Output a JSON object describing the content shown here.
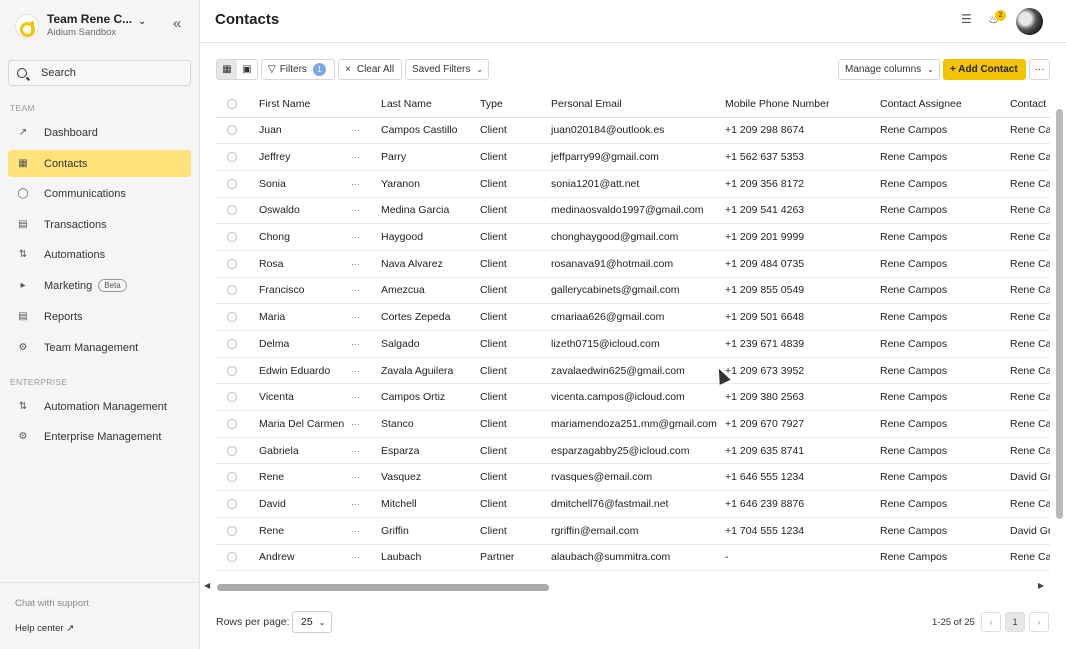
{
  "sidebar": {
    "team_name": "Team Rene C...",
    "team_sub": "Aidium Sandbox",
    "search_placeholder": "Search",
    "section_team": "TEAM",
    "section_enterprise": "ENTERPRISE",
    "items": [
      {
        "label": "Dashboard",
        "icon": "chart-icon"
      },
      {
        "label": "Contacts",
        "icon": "contacts-icon",
        "active": true
      },
      {
        "label": "Communications",
        "icon": "chat-icon"
      },
      {
        "label": "Transactions",
        "icon": "document-icon"
      },
      {
        "label": "Automations",
        "icon": "automation-icon"
      },
      {
        "label": "Marketing",
        "icon": "megaphone-icon",
        "badge": "Beta"
      },
      {
        "label": "Reports",
        "icon": "report-icon"
      },
      {
        "label": "Team Management",
        "icon": "gear-icon"
      }
    ],
    "enterprise_items": [
      {
        "label": "Automation Management",
        "icon": "automation-icon"
      },
      {
        "label": "Enterprise Management",
        "icon": "gear-icon"
      }
    ],
    "chat_support": "Chat with support",
    "help_center": "Help center"
  },
  "header": {
    "title": "Contacts",
    "notification_count": "2"
  },
  "toolbar": {
    "filters_label": "Filters",
    "filters_count": "1",
    "clear_all": "Clear All",
    "saved_filters": "Saved Filters",
    "manage_columns": "Manage columns",
    "add_contact": "+ Add Contact",
    "more": "···"
  },
  "table": {
    "columns": [
      "First Name",
      "Last Name",
      "Type",
      "Personal Email",
      "Mobile Phone Number",
      "Contact Assignee",
      "Contact"
    ],
    "rows": [
      [
        "Juan",
        "Campos Castillo",
        "Client",
        "juan020184@outlook.es",
        "+1 209 298 8674",
        "Rene Campos",
        "Rene Ca"
      ],
      [
        "Jeffrey",
        "Parry",
        "Client",
        "jeffparry99@gmail.com",
        "+1 562 637 5353",
        "Rene Campos",
        "Rene Ca"
      ],
      [
        "Sonia",
        "Yaranon",
        "Client",
        "sonia1201@att.net",
        "+1 209 356 8172",
        "Rene Campos",
        "Rene Ca"
      ],
      [
        "Oswaldo",
        "Medina Garcia",
        "Client",
        "medinaosvaldo1997@gmail.com",
        "+1 209 541 4263",
        "Rene Campos",
        "Rene Ca"
      ],
      [
        "Chong",
        "Haygood",
        "Client",
        "chonghaygood@gmail.com",
        "+1 209 201 9999",
        "Rene Campos",
        "Rene Ca"
      ],
      [
        "Rosa",
        "Nava Alvarez",
        "Client",
        "rosanava91@hotmail.com",
        "+1 209 484 0735",
        "Rene Campos",
        "Rene Ca"
      ],
      [
        "Francisco",
        "Amezcua",
        "Client",
        "gallerycabinets@gmail.com",
        "+1 209 855 0549",
        "Rene Campos",
        "Rene Ca"
      ],
      [
        "Maria",
        "Cortes Zepeda",
        "Client",
        "cmariaa626@gmail.com",
        "+1 209 501 6648",
        "Rene Campos",
        "Rene Ca"
      ],
      [
        "Delma",
        "Salgado",
        "Client",
        "lizeth0715@icloud.com",
        "+1 239 671 4839",
        "Rene Campos",
        "Rene Ca"
      ],
      [
        "Edwin Eduardo",
        "Zavala Aguilera",
        "Client",
        "zavalaedwin625@gmail.com",
        "+1 209 673 3952",
        "Rene Campos",
        "Rene Ca"
      ],
      [
        "Vicenta",
        "Campos Ortiz",
        "Client",
        "vicenta.campos@icloud.com",
        "+1 209 380 2563",
        "Rene Campos",
        "Rene Ca"
      ],
      [
        "Maria Del Carmen",
        "Stanco",
        "Client",
        "mariamendoza251.mm@gmail.com",
        "+1 209 670 7927",
        "Rene Campos",
        "Rene Ca"
      ],
      [
        "Gabriela",
        "Esparza",
        "Client",
        "esparzagabby25@icloud.com",
        "+1 209 635 8741",
        "Rene Campos",
        "Rene Ca"
      ],
      [
        "Rene",
        "Vasquez",
        "Client",
        "rvasques@email.com",
        "+1 646 555 1234",
        "Rene Campos",
        "David Gr"
      ],
      [
        "David",
        "Mitchell",
        "Client",
        "dmitchell76@fastmail.net",
        "+1 646 239 8876",
        "Rene Campos",
        "Rene Ca"
      ],
      [
        "Rene",
        "Griffin",
        "Client",
        "rgriffin@email.com",
        "+1 704 555 1234",
        "Rene Campos",
        "David Gr"
      ],
      [
        "Andrew",
        "Laubach",
        "Partner",
        "alaubach@summitra.com",
        "-",
        "Rene Campos",
        "Rene Ca"
      ]
    ]
  },
  "footer": {
    "rows_per_page_label": "Rows per page:",
    "rows_per_page_value": "25",
    "range": "1-25 of 25",
    "current_page": "1"
  }
}
